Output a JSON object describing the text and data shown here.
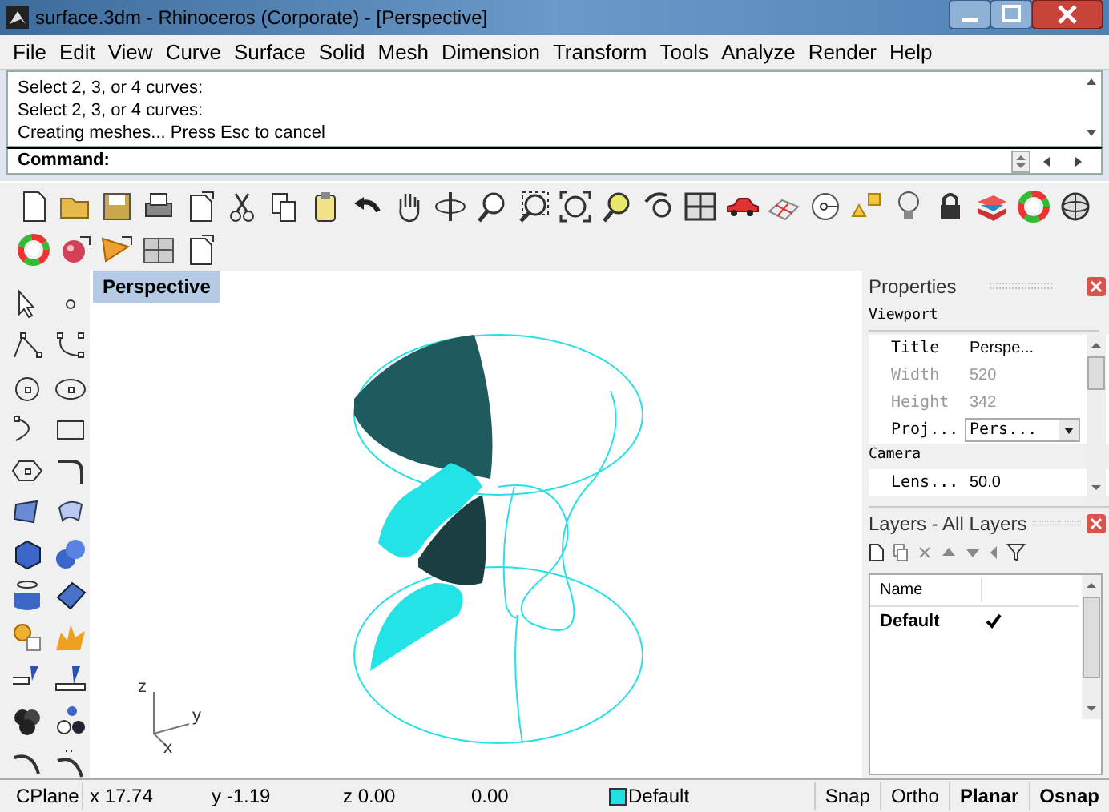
{
  "window": {
    "title": "surface.3dm - Rhinoceros (Corporate) - [Perspective]"
  },
  "menu": [
    "File",
    "Edit",
    "View",
    "Curve",
    "Surface",
    "Solid",
    "Mesh",
    "Dimension",
    "Transform",
    "Tools",
    "Analyze",
    "Render",
    "Help"
  ],
  "command_history": [
    "Select 2, 3, or 4 curves:",
    "Select 2, 3, or 4 curves:",
    "Creating meshes... Press Esc to cancel"
  ],
  "command_prompt": "Command:",
  "viewport": {
    "tab": "Perspective",
    "axes": [
      "z",
      "y",
      "x"
    ]
  },
  "properties": {
    "title": "Properties",
    "section": "Viewport",
    "rows": [
      {
        "label": "Title",
        "value": "Perspe...",
        "disabled": false,
        "kind": "text"
      },
      {
        "label": "Width",
        "value": "520",
        "disabled": true,
        "kind": "text"
      },
      {
        "label": "Height",
        "value": "342",
        "disabled": true,
        "kind": "text"
      },
      {
        "label": "Proj...",
        "value": "Pers...",
        "disabled": false,
        "kind": "dropdown"
      }
    ],
    "section_2": "Camera",
    "rows_2": [
      {
        "label": "Lens...",
        "value": "50.0",
        "disabled": false
      }
    ]
  },
  "layers": {
    "title": "Layers - All Layers",
    "column": "Name",
    "rows": [
      {
        "name": "Default",
        "current": true
      }
    ]
  },
  "status_bar": {
    "cplane": "CPlane",
    "x": "x 17.74",
    "y": "y -1.19",
    "z": "z 0.00",
    "distance": "0.00",
    "layer": {
      "name": "Default",
      "color": "#22e0e0"
    },
    "panes": [
      {
        "label": "Snap",
        "on": false
      },
      {
        "label": "Ortho",
        "on": false
      },
      {
        "label": "Planar",
        "on": true
      },
      {
        "label": "Osnap",
        "on": true
      }
    ]
  }
}
